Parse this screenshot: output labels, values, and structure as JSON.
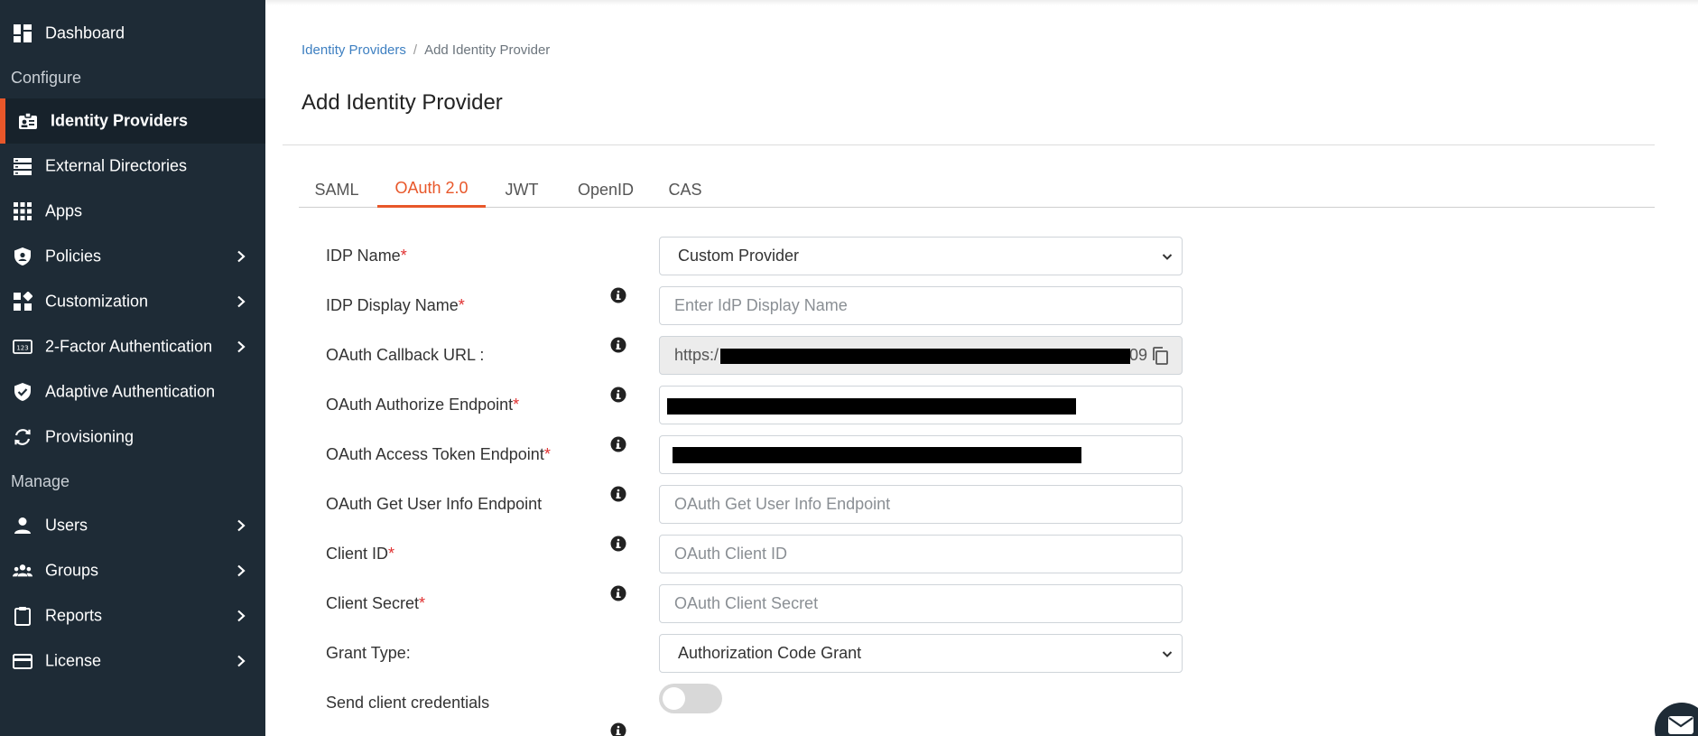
{
  "sidebar": {
    "dashboard": "Dashboard",
    "configure_heading": "Configure",
    "identity_providers": "Identity Providers",
    "external_directories": "External Directories",
    "apps": "Apps",
    "policies": "Policies",
    "customization": "Customization",
    "two_factor": "2-Factor Authentication",
    "adaptive": "Adaptive Authentication",
    "provisioning": "Provisioning",
    "manage_heading": "Manage",
    "users": "Users",
    "groups": "Groups",
    "reports": "Reports",
    "license": "License"
  },
  "breadcrumb": {
    "parent": "Identity Providers",
    "separator": "/",
    "current": "Add Identity Provider"
  },
  "page_title": "Add Identity Provider",
  "tabs": {
    "saml": "SAML",
    "oauth": "OAuth 2.0",
    "jwt": "JWT",
    "openid": "OpenID",
    "cas": "CAS",
    "active": "OAuth 2.0"
  },
  "form": {
    "required_mark": "*",
    "idp_name": {
      "label": "IDP Name",
      "value": "Custom Provider"
    },
    "idp_display_name": {
      "label": "IDP Display Name",
      "placeholder": "Enter IdP Display Name"
    },
    "callback_url": {
      "label": "OAuth Callback URL :",
      "visible_prefix": "https:/",
      "visible_suffix": "09"
    },
    "authorize_endpoint": {
      "label": "OAuth Authorize Endpoint"
    },
    "token_endpoint": {
      "label": "OAuth Access Token Endpoint"
    },
    "user_info_endpoint": {
      "label": "OAuth Get User Info Endpoint",
      "placeholder": "OAuth Get User Info Endpoint"
    },
    "client_id": {
      "label": "Client ID",
      "placeholder": "OAuth Client ID"
    },
    "client_secret": {
      "label": "Client Secret",
      "placeholder": "OAuth Client Secret"
    },
    "grant_type": {
      "label": "Grant Type:",
      "value": "Authorization Code Grant"
    },
    "send_credentials": {
      "label": "Send client credentials",
      "enabled": false
    }
  },
  "colors": {
    "sidebar_bg": "#1e2b36",
    "accent": "#e8572a",
    "link": "#3d7fc1",
    "required": "#e03131"
  },
  "icons": {
    "info": "info-circle-icon",
    "copy": "copy-icon",
    "chevron": "chevron-right-icon",
    "select_caret": "chevron-down-icon",
    "chat": "mail-icon"
  }
}
